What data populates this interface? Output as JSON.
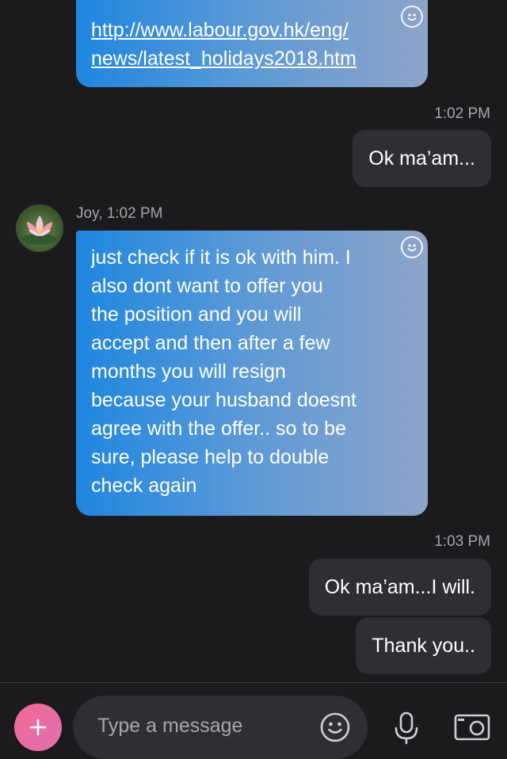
{
  "messages": {
    "link_line1": "http://www.labour.gov.hk/eng/",
    "link_line2": "news/latest_holidays2018.htm",
    "time_1": "1:02 PM",
    "reply_1": "Ok ma’am...",
    "sender_meta": "Joy, 1:02 PM",
    "incoming_lines": [
      "just check if it is ok with him. I",
      "also dont want to offer you",
      "the position and you will",
      "accept and then after a few",
      "months you will resign",
      "because your husband doesnt",
      "agree with the offer.. so to be",
      "sure, please help to double",
      "check again"
    ],
    "time_2": "1:03 PM",
    "reply_2": "Ok ma’am...I will.",
    "reply_3": "Thank you.."
  },
  "composer": {
    "placeholder": "Type a message",
    "add_icon": "plus-icon",
    "emoji_icon": "emoji-icon",
    "mic_icon": "microphone-icon",
    "camera_icon": "camera-icon"
  },
  "colors": {
    "background": "#1b1b1d",
    "outgoing_bubble": "#2e2e33",
    "incoming_gradient_start": "#1f86e0",
    "incoming_gradient_end": "#8ea4c9",
    "add_button": "#e5679b"
  }
}
